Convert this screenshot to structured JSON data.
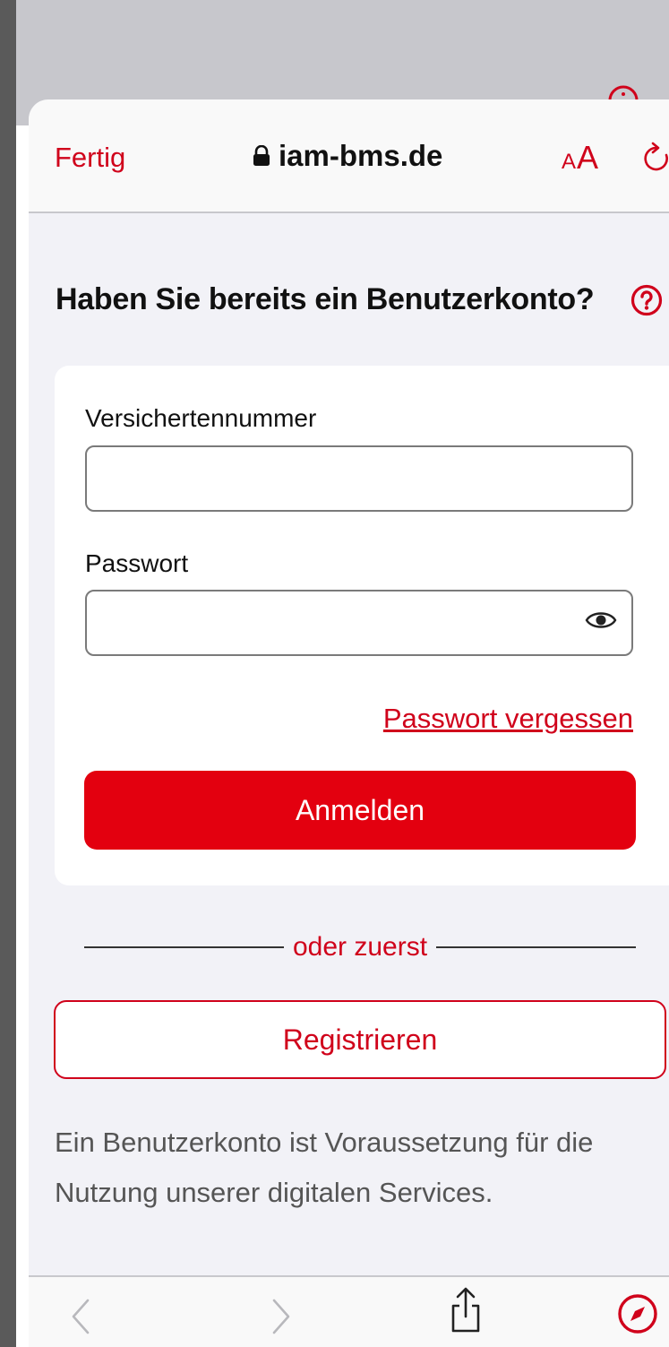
{
  "browser": {
    "done_label": "Fertig",
    "domain": "iam-bms.de",
    "text_size_small": "A",
    "text_size_large": "A"
  },
  "login": {
    "heading": "Haben Sie bereits ein Benutzerkonto?",
    "insurance_number_label": "Versichertennummer",
    "insurance_number_value": "",
    "password_label": "Passwort",
    "password_value": "",
    "forgot_password": "Passwort vergessen",
    "submit_label": "Anmelden"
  },
  "divider_text": "oder zuerst",
  "register_label": "Registrieren",
  "info_text": "Ein Benutzerkonto ist Voraussetzung für die Nutzung unserer digitalen Services.",
  "colors": {
    "accent": "#e3000f",
    "link": "#d0021b",
    "sheet_background": "#f2f2f7"
  },
  "icons": [
    "lock-icon",
    "reload-icon",
    "help-icon",
    "eye-icon",
    "back-icon",
    "forward-icon",
    "share-icon",
    "compass-icon"
  ]
}
